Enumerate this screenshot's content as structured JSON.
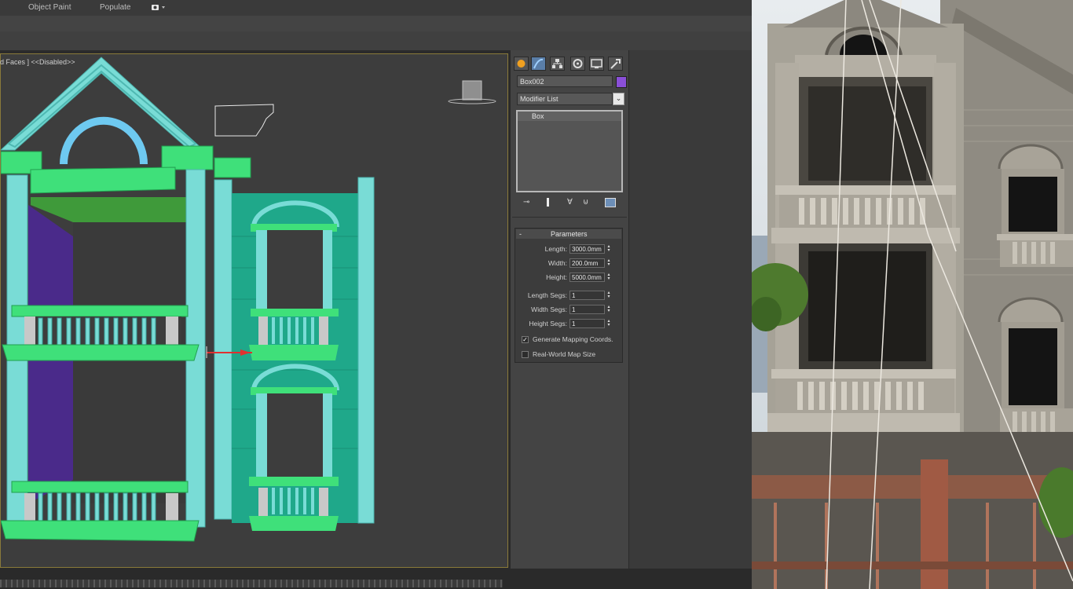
{
  "ribbon": {
    "tabs": [
      "Object Paint",
      "Populate"
    ],
    "dropdown_icon": "display-toggle-icon"
  },
  "viewport": {
    "label": "d Faces ] <<Disabled>>"
  },
  "command_panel": {
    "tab_icons": [
      "create-icon",
      "modify-icon",
      "hierarchy-icon",
      "motion-icon",
      "display-icon",
      "utilities-icon"
    ],
    "object_name": "Box002",
    "object_color": "#8a4fd8",
    "modifier_list_label": "Modifier List",
    "stack_items": [
      "Box"
    ],
    "rollout_title": "Parameters",
    "params": [
      {
        "label": "Length:",
        "value": "3000.0mm"
      },
      {
        "label": "Width:",
        "value": "200.0mm"
      },
      {
        "label": "Height:",
        "value": "5000.0mm"
      }
    ],
    "segs": [
      {
        "label": "Length Segs:",
        "value": "1"
      },
      {
        "label": "Width Segs:",
        "value": "1"
      },
      {
        "label": "Height Segs:",
        "value": "1"
      }
    ],
    "checkboxes": [
      {
        "label": "Generate Mapping Coords.",
        "checked": true,
        "mark": "✓"
      },
      {
        "label": "Real-World Map Size",
        "checked": false,
        "mark": ""
      }
    ]
  }
}
